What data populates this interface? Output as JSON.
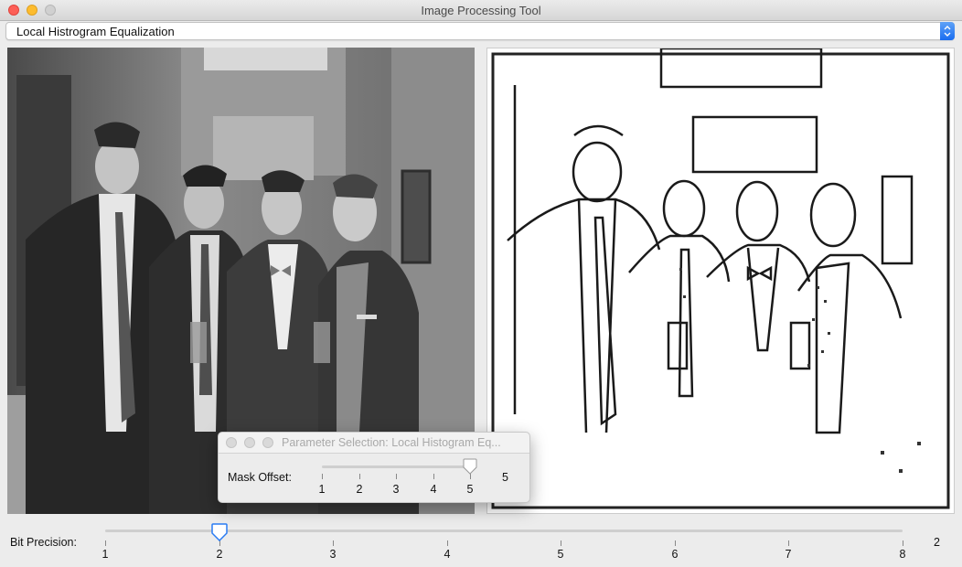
{
  "window": {
    "title": "Image Processing Tool",
    "controls": [
      "close-icon",
      "minimize-icon",
      "maximize-icon"
    ]
  },
  "mode_select": {
    "selected": "Local Histrogram Equalization",
    "stepper_icon": "up-down-chevron-icon",
    "accent_color": "#1a6df0"
  },
  "images": {
    "left_pane": "original-grayscale-photo",
    "right_pane": "local-histogram-equalized-photo"
  },
  "dialog": {
    "title": "Parameter Selection: Local Histogram Eq...",
    "mask_offset": {
      "label": "Mask Offset:",
      "ticks": [
        "1",
        "2",
        "3",
        "4",
        "5"
      ],
      "value": 5,
      "value_text": "5",
      "min": 1,
      "max": 5
    }
  },
  "bit_precision": {
    "label": "Bit Precision:",
    "ticks": [
      "1",
      "2",
      "3",
      "4",
      "5",
      "6",
      "7",
      "8"
    ],
    "value": 2,
    "value_text": "2",
    "min": 1,
    "max": 8
  }
}
